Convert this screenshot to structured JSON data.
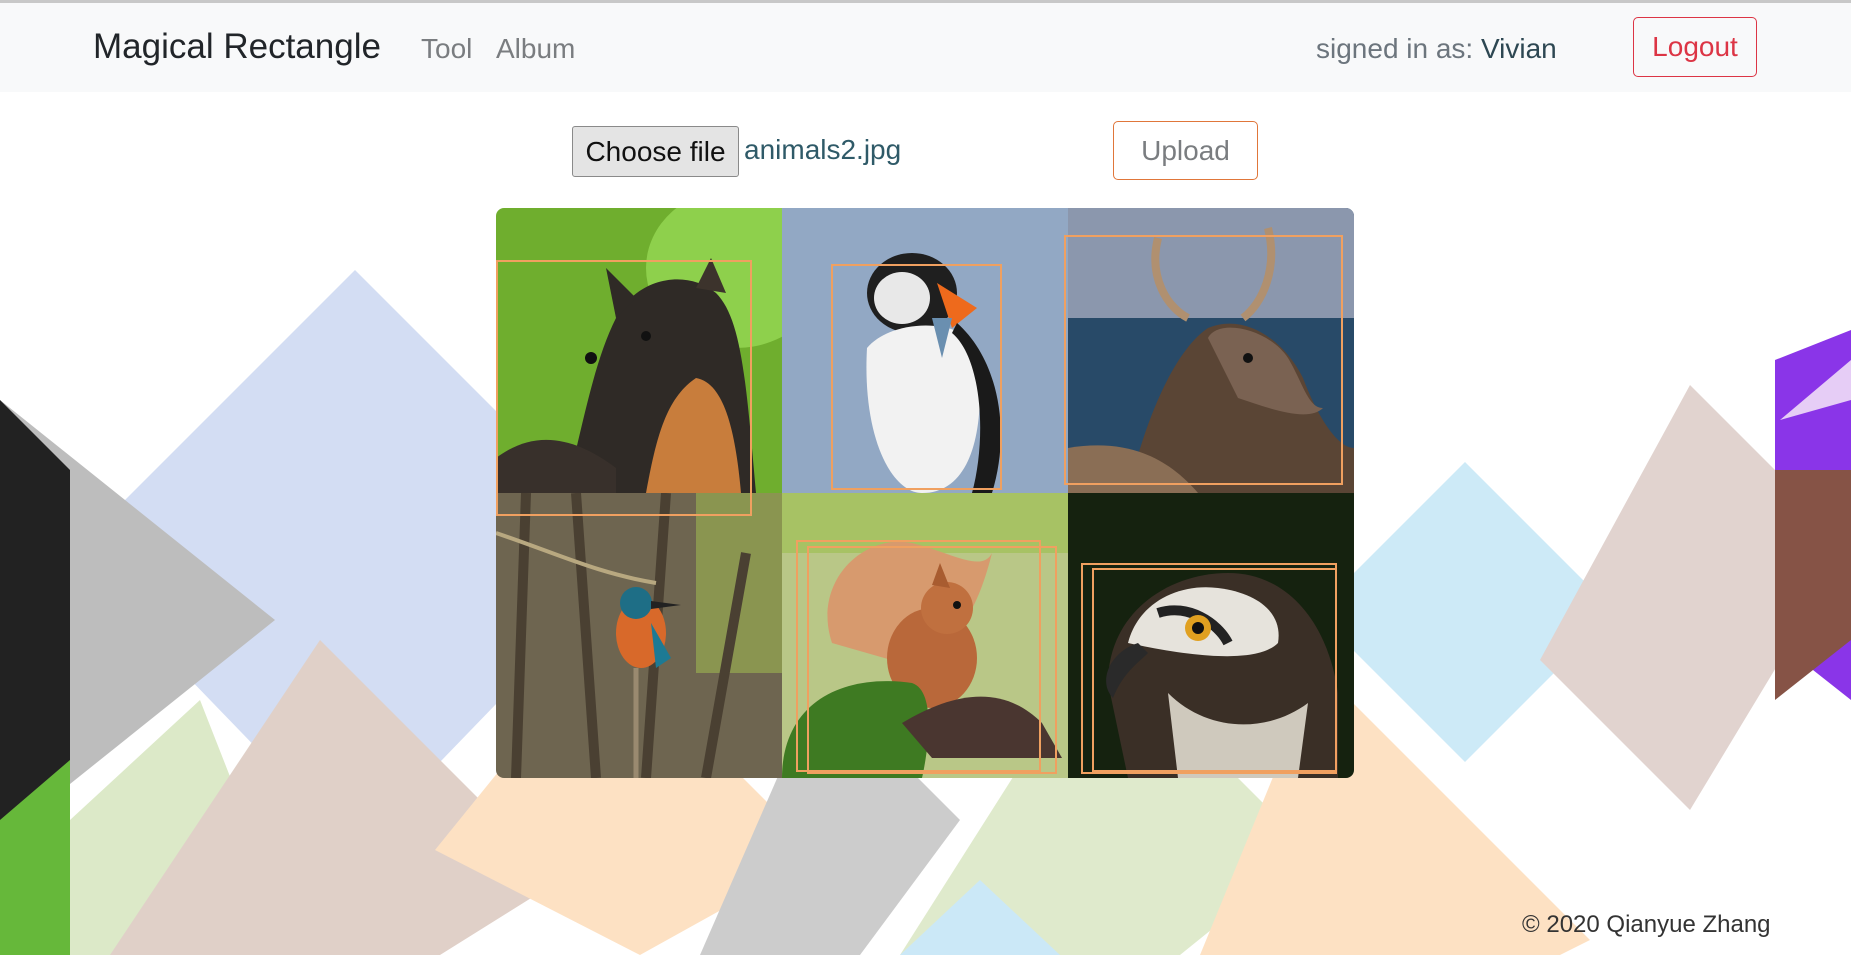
{
  "navbar": {
    "brand": "Magical Rectangle",
    "links": [
      {
        "label": "Tool"
      },
      {
        "label": "Album"
      }
    ],
    "signed_in_prefix": "signed in as: ",
    "username": "Vivian",
    "logout_label": "Logout"
  },
  "uploader": {
    "choose_file_label": "Choose file",
    "file_name": "animals2.jpg",
    "upload_label": "Upload"
  },
  "image_grid": {
    "tiles": [
      {
        "subject": "marten"
      },
      {
        "subject": "puffin"
      },
      {
        "subject": "red deer stag"
      },
      {
        "subject": "kingfisher"
      },
      {
        "subject": "red squirrel"
      },
      {
        "subject": "osprey"
      }
    ],
    "box_color": "#f0a060"
  },
  "footer": {
    "text": "© 2020 Qianyue Zhang"
  },
  "colors": {
    "logout": "#dc3545",
    "upload_border": "#e0763a",
    "navbar_bg": "#f8f9fa"
  }
}
